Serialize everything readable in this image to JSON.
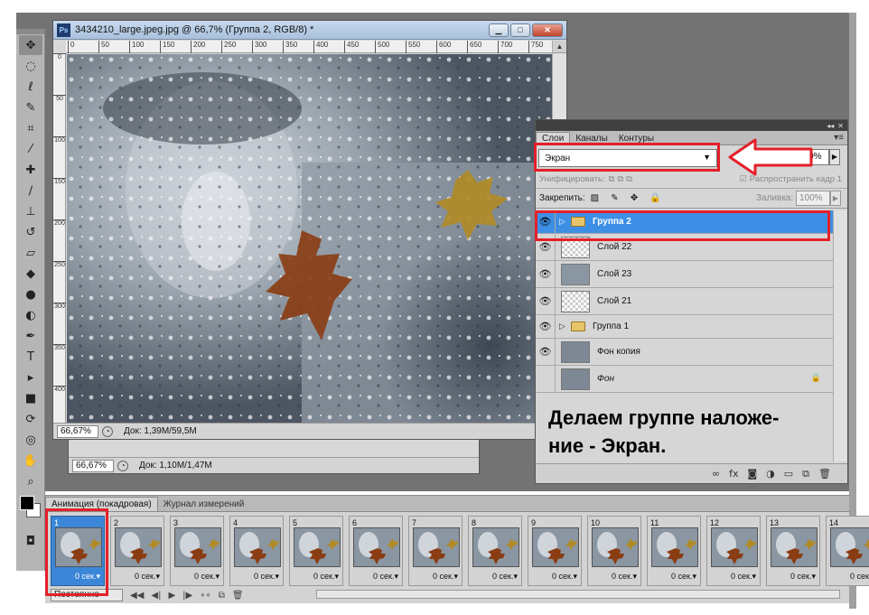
{
  "document": {
    "title": "3434210_large.jpeg.jpg @ 66,7% (Группа 2, RGB/8) *",
    "ps_badge": "Ps",
    "zoom": "66,67%",
    "doc_size": "Док: 1,39M/59,5M",
    "ruler_ticks": [
      "0",
      "50",
      "100",
      "150",
      "200",
      "250",
      "300",
      "350",
      "400",
      "450",
      "500",
      "550",
      "600",
      "650",
      "700",
      "750"
    ]
  },
  "document_back": {
    "zoom": "66,67%",
    "doc_size": "Док: 1,10M/1,47M"
  },
  "layers_panel": {
    "tabs": [
      "Слои",
      "Каналы",
      "Контуры"
    ],
    "blend_mode": "Экран",
    "opacity_label": "е",
    "opacity_value": "100%",
    "unify_label": "Унифицировать:",
    "propagate_label": "Распространить кадр 1",
    "lock_label": "Закрепить:",
    "fill_label": "Заливка:",
    "fill_value": "100%",
    "layers": [
      {
        "name": "Группа 2",
        "type": "group",
        "selected": true,
        "visible": true
      },
      {
        "name": "Слой 22",
        "type": "layer",
        "selected": false,
        "visible": true
      },
      {
        "name": "Слой 23",
        "type": "layer",
        "selected": false,
        "visible": true
      },
      {
        "name": "Слой 21",
        "type": "layer",
        "selected": false,
        "visible": true
      },
      {
        "name": "Группа 1",
        "type": "group",
        "selected": false,
        "visible": true
      },
      {
        "name": "Фон копия",
        "type": "layer",
        "selected": false,
        "visible": true
      },
      {
        "name": "Фон",
        "type": "background",
        "selected": false,
        "visible": false,
        "locked": true
      }
    ]
  },
  "caption": {
    "line1": "Делаем группе наложе-",
    "line2": "ние  - Экран."
  },
  "animation_panel": {
    "tabs": [
      "Анимация (покадровая)",
      "Журнал измерений"
    ],
    "loop_value": "Постоянно",
    "frames": [
      {
        "num": "1",
        "delay": "0 сек."
      },
      {
        "num": "2",
        "delay": "0 сек."
      },
      {
        "num": "3",
        "delay": "0 сек."
      },
      {
        "num": "4",
        "delay": "0 сек."
      },
      {
        "num": "5",
        "delay": "0 сек."
      },
      {
        "num": "6",
        "delay": "0 сек."
      },
      {
        "num": "7",
        "delay": "0 сек."
      },
      {
        "num": "8",
        "delay": "0 сек."
      },
      {
        "num": "9",
        "delay": "0 сек."
      },
      {
        "num": "10",
        "delay": "0 сек."
      },
      {
        "num": "11",
        "delay": "0 сек."
      },
      {
        "num": "12",
        "delay": "0 сек."
      },
      {
        "num": "13",
        "delay": "0 сек."
      },
      {
        "num": "14",
        "delay": "0 сек."
      }
    ]
  },
  "colors": {
    "highlight": "#e3202a",
    "selection": "#3d8fe6",
    "workspace": "#737373"
  }
}
